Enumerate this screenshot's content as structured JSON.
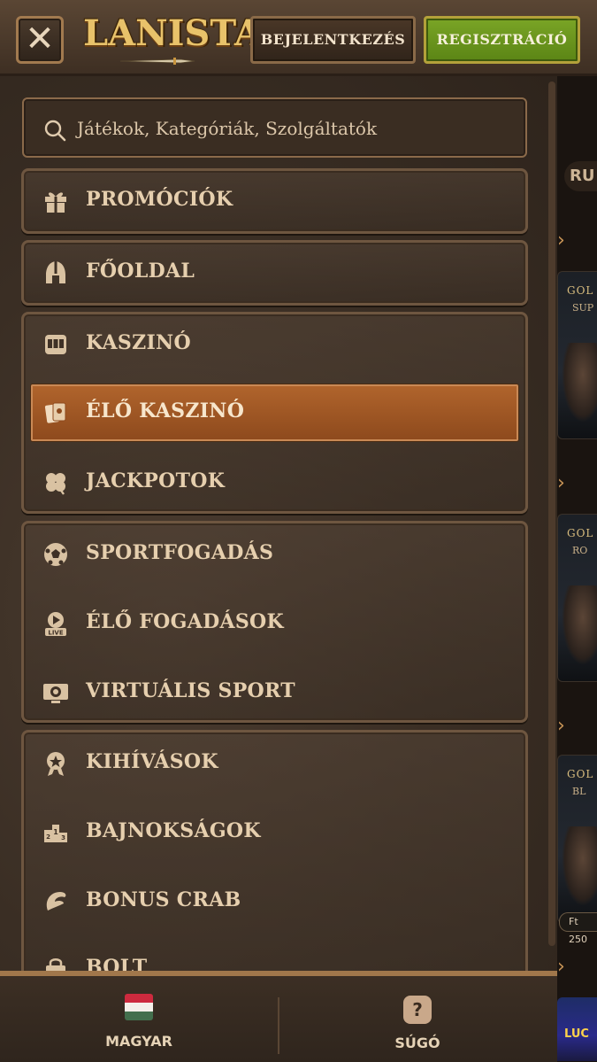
{
  "header": {
    "close_icon": "close-icon",
    "logo_text": "LANISTA",
    "login_label": "BEJELENTKEZÉS",
    "register_label": "REGISZTRÁCIÓ"
  },
  "search": {
    "placeholder": "Játékok, Kategóriák, Szolgáltatók"
  },
  "menu": {
    "items": [
      {
        "label": "PROMÓCIÓK",
        "icon": "gift-icon"
      },
      {
        "label": "FŐOLDAL",
        "icon": "helmet-icon"
      },
      {
        "label": "KASZINÓ",
        "icon": "slot-machine-icon"
      },
      {
        "label": "ÉLŐ KASZINÓ",
        "icon": "cards-icon",
        "active": true
      },
      {
        "label": "JACKPOTOK",
        "icon": "clover-icon"
      },
      {
        "label": "SPORTFOGADÁS",
        "icon": "soccer-ball-icon"
      },
      {
        "label": "ÉLŐ FOGADÁSOK",
        "icon": "live-play-icon"
      },
      {
        "label": "VIRTUÁLIS SPORT",
        "icon": "virtual-sport-icon"
      },
      {
        "label": "KIHÍVÁSOK",
        "icon": "medal-icon"
      },
      {
        "label": "BAJNOKSÁGOK",
        "icon": "podium-icon"
      },
      {
        "label": "BONUS CRAB",
        "icon": "crab-claw-icon"
      },
      {
        "label": "BOLT",
        "icon": "shop-bag-icon"
      }
    ]
  },
  "bottom_bar": {
    "language_label": "MAGYAR",
    "help_label": "SÚGÓ",
    "help_glyph": "?"
  },
  "background": {
    "chip_text": "RU",
    "card_texts": [
      "GOL",
      "SUP",
      "GOL",
      "RO",
      "GOL",
      "BL"
    ],
    "badge_text": "Ft 250",
    "bottom_card_text": "LUC"
  },
  "colors": {
    "active_item": "#a0572a",
    "register_button": "#6f9a20",
    "panel_border": "#6e5640"
  }
}
